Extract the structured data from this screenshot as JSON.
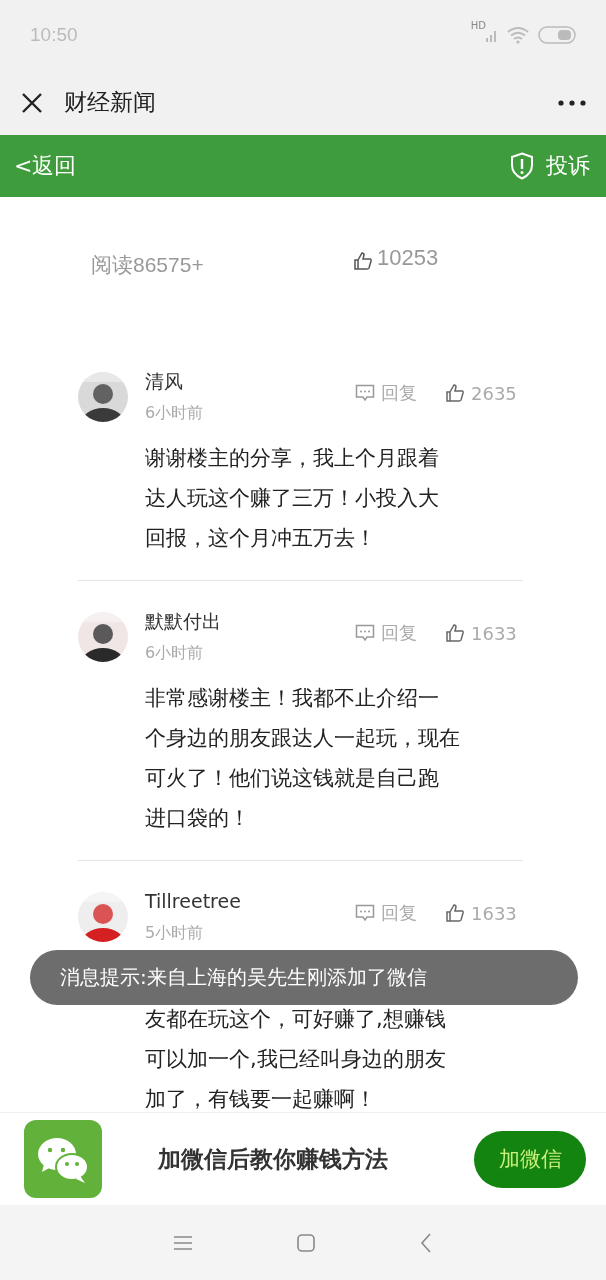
{
  "status_bar": {
    "time": "10:50",
    "network": "HD"
  },
  "title_bar": {
    "title": "财经新闻"
  },
  "green_bar": {
    "back": "<返回",
    "report": "投诉"
  },
  "stats": {
    "reads": "阅读86575+",
    "likes": "10253"
  },
  "comments": [
    {
      "name": "清风",
      "time": "6小时前",
      "reply": "回复",
      "likes": "2635",
      "first_line_covered": false,
      "lines": [
        "谢谢楼主的分享，我上个月跟着",
        "达人玩这个赚了三万！小投入大",
        "回报，这个月冲五万去！"
      ]
    },
    {
      "name": "默默付出",
      "time": "6小时前",
      "reply": "回复",
      "likes": "1633",
      "first_line_covered": false,
      "lines": [
        "非常感谢楼主！我都不止介绍一",
        "个身边的朋友跟达人一起玩，现在",
        "可火了！他们说这钱就是自己跑",
        "进口袋的！"
      ]
    },
    {
      "name": "Tillreetree",
      "time": "5小时前",
      "reply": "回复",
      "likes": "1633",
      "first_line_covered": true,
      "lines": [
        "友都在玩这个，可好赚了,想赚钱",
        "可以加一个,我已经叫身边的朋友",
        "加了，有钱要一起赚啊！"
      ]
    }
  ],
  "toast": "消息提示:来自上海的吴先生刚添加了微信",
  "bottom_bar": {
    "text": "加微信后教你赚钱方法",
    "button": "加微信"
  }
}
